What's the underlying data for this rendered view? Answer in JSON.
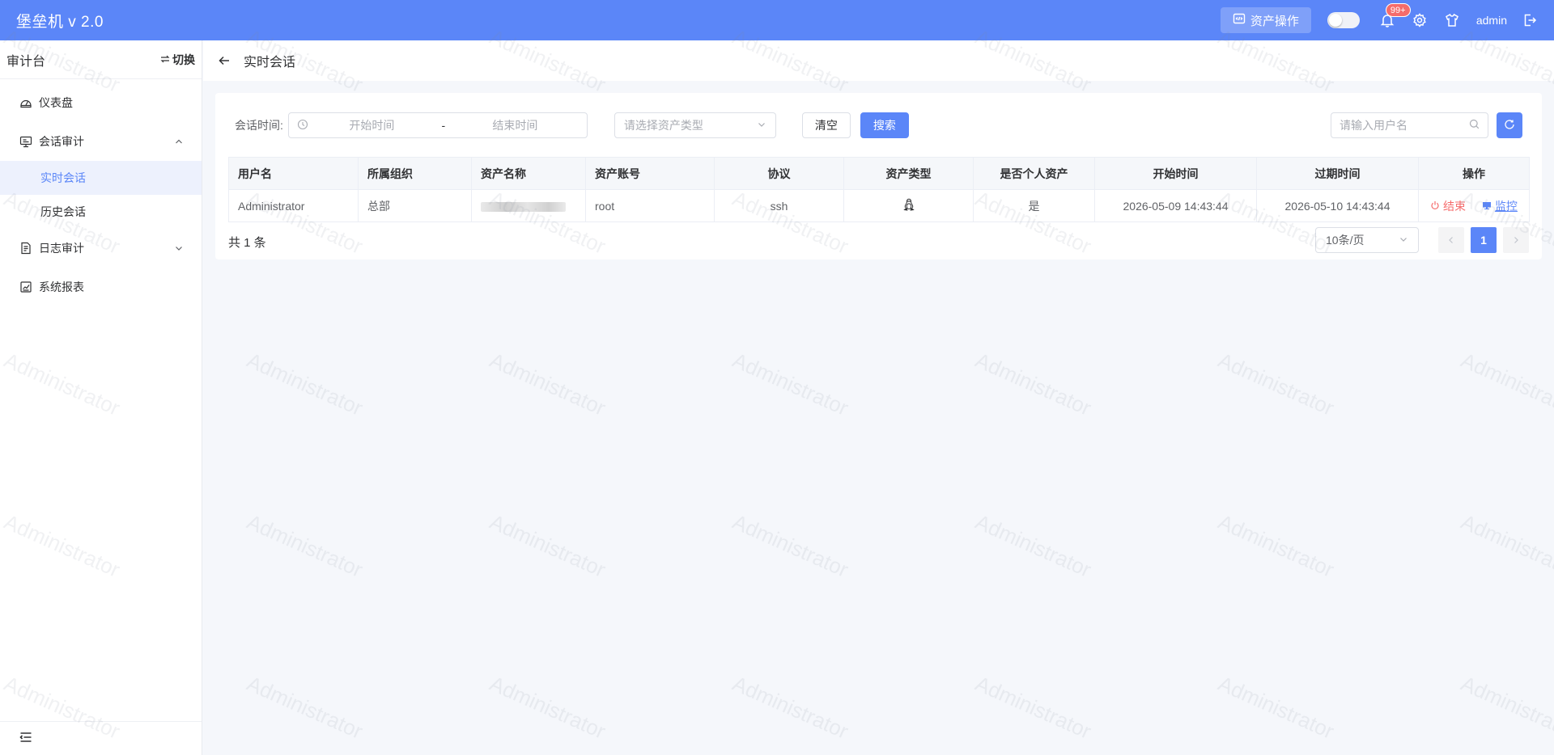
{
  "header": {
    "brand": "堡垒机 v 2.0",
    "asset_op_label": "资产操作",
    "notification_badge": "99+",
    "username": "admin"
  },
  "sidebar": {
    "title": "审计台",
    "switch_label": "切换",
    "items": [
      {
        "label": "仪表盘"
      },
      {
        "label": "会话审计",
        "expanded": true,
        "children": [
          {
            "label": "实时会话",
            "active": true
          },
          {
            "label": "历史会话"
          }
        ]
      },
      {
        "label": "日志审计",
        "expanded": false
      },
      {
        "label": "系统报表"
      }
    ]
  },
  "page": {
    "title": "实时会话"
  },
  "filters": {
    "session_time_label": "会话时间:",
    "start_placeholder": "开始时间",
    "range_separator": "-",
    "end_placeholder": "结束时间",
    "asset_type_placeholder": "请选择资产类型",
    "clear_label": "清空",
    "search_label": "搜索",
    "username_placeholder": "请输入用户名"
  },
  "table": {
    "headers": [
      "用户名",
      "所属组织",
      "资产名称",
      "资产账号",
      "协议",
      "资产类型",
      "是否个人资产",
      "开始时间",
      "过期时间",
      "操作"
    ],
    "rows": [
      {
        "username": "Administrator",
        "org": "总部",
        "asset_name": "",
        "account": "root",
        "protocol": "ssh",
        "asset_type_icon": "linux-icon",
        "personal": "是",
        "start_time": "2026-05-09 14:43:44",
        "expire_time": "2026-05-10 14:43:44",
        "end_label": "结束",
        "monitor_label": "监控"
      }
    ]
  },
  "pagination": {
    "total_text": "共 1 条",
    "page_size": "10条/页",
    "current_page": "1"
  },
  "watermark": "Administrator",
  "colors": {
    "primary": "#5b86f8",
    "danger": "#f56c6c",
    "background": "#f5f7fb"
  }
}
